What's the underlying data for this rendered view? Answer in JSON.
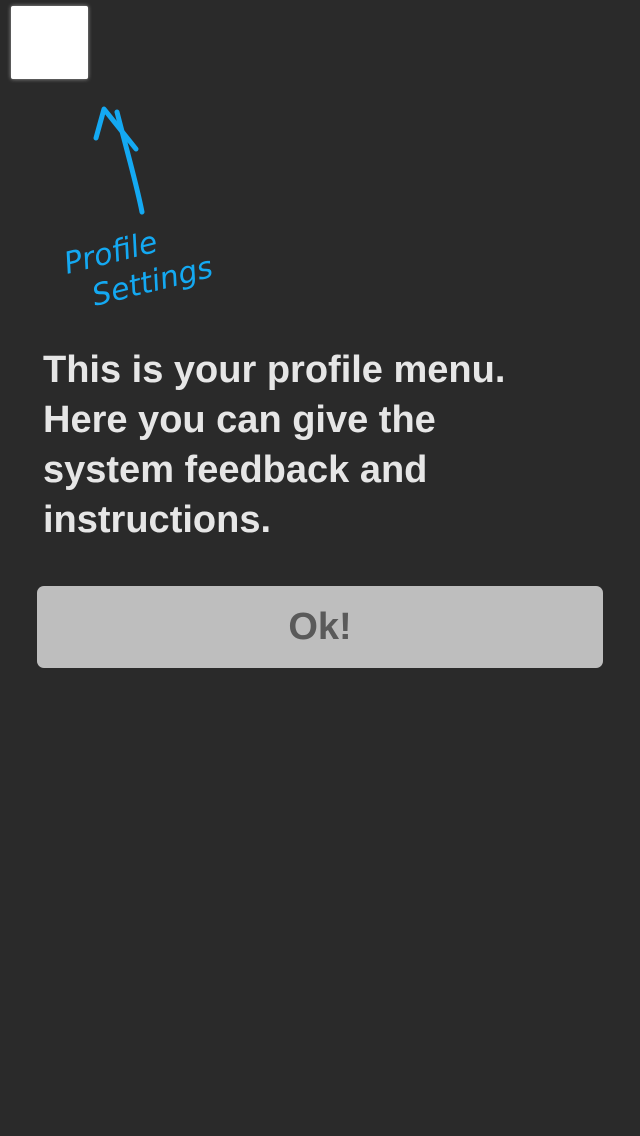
{
  "profile_button": {
    "icon": "profile-square-icon"
  },
  "annotation": {
    "line1": "Profile",
    "line2": "Settings",
    "color": "#14a9f2"
  },
  "hint": {
    "text": "This is your profile menu.\nHere you can give the\nsystem feedback and\ninstructions."
  },
  "ok_button": {
    "label": "Ok!"
  },
  "colors": {
    "background": "#2a2a2a",
    "text": "#e6e6e6",
    "button_bg": "#bebebe",
    "button_text": "#5a5a5a"
  }
}
